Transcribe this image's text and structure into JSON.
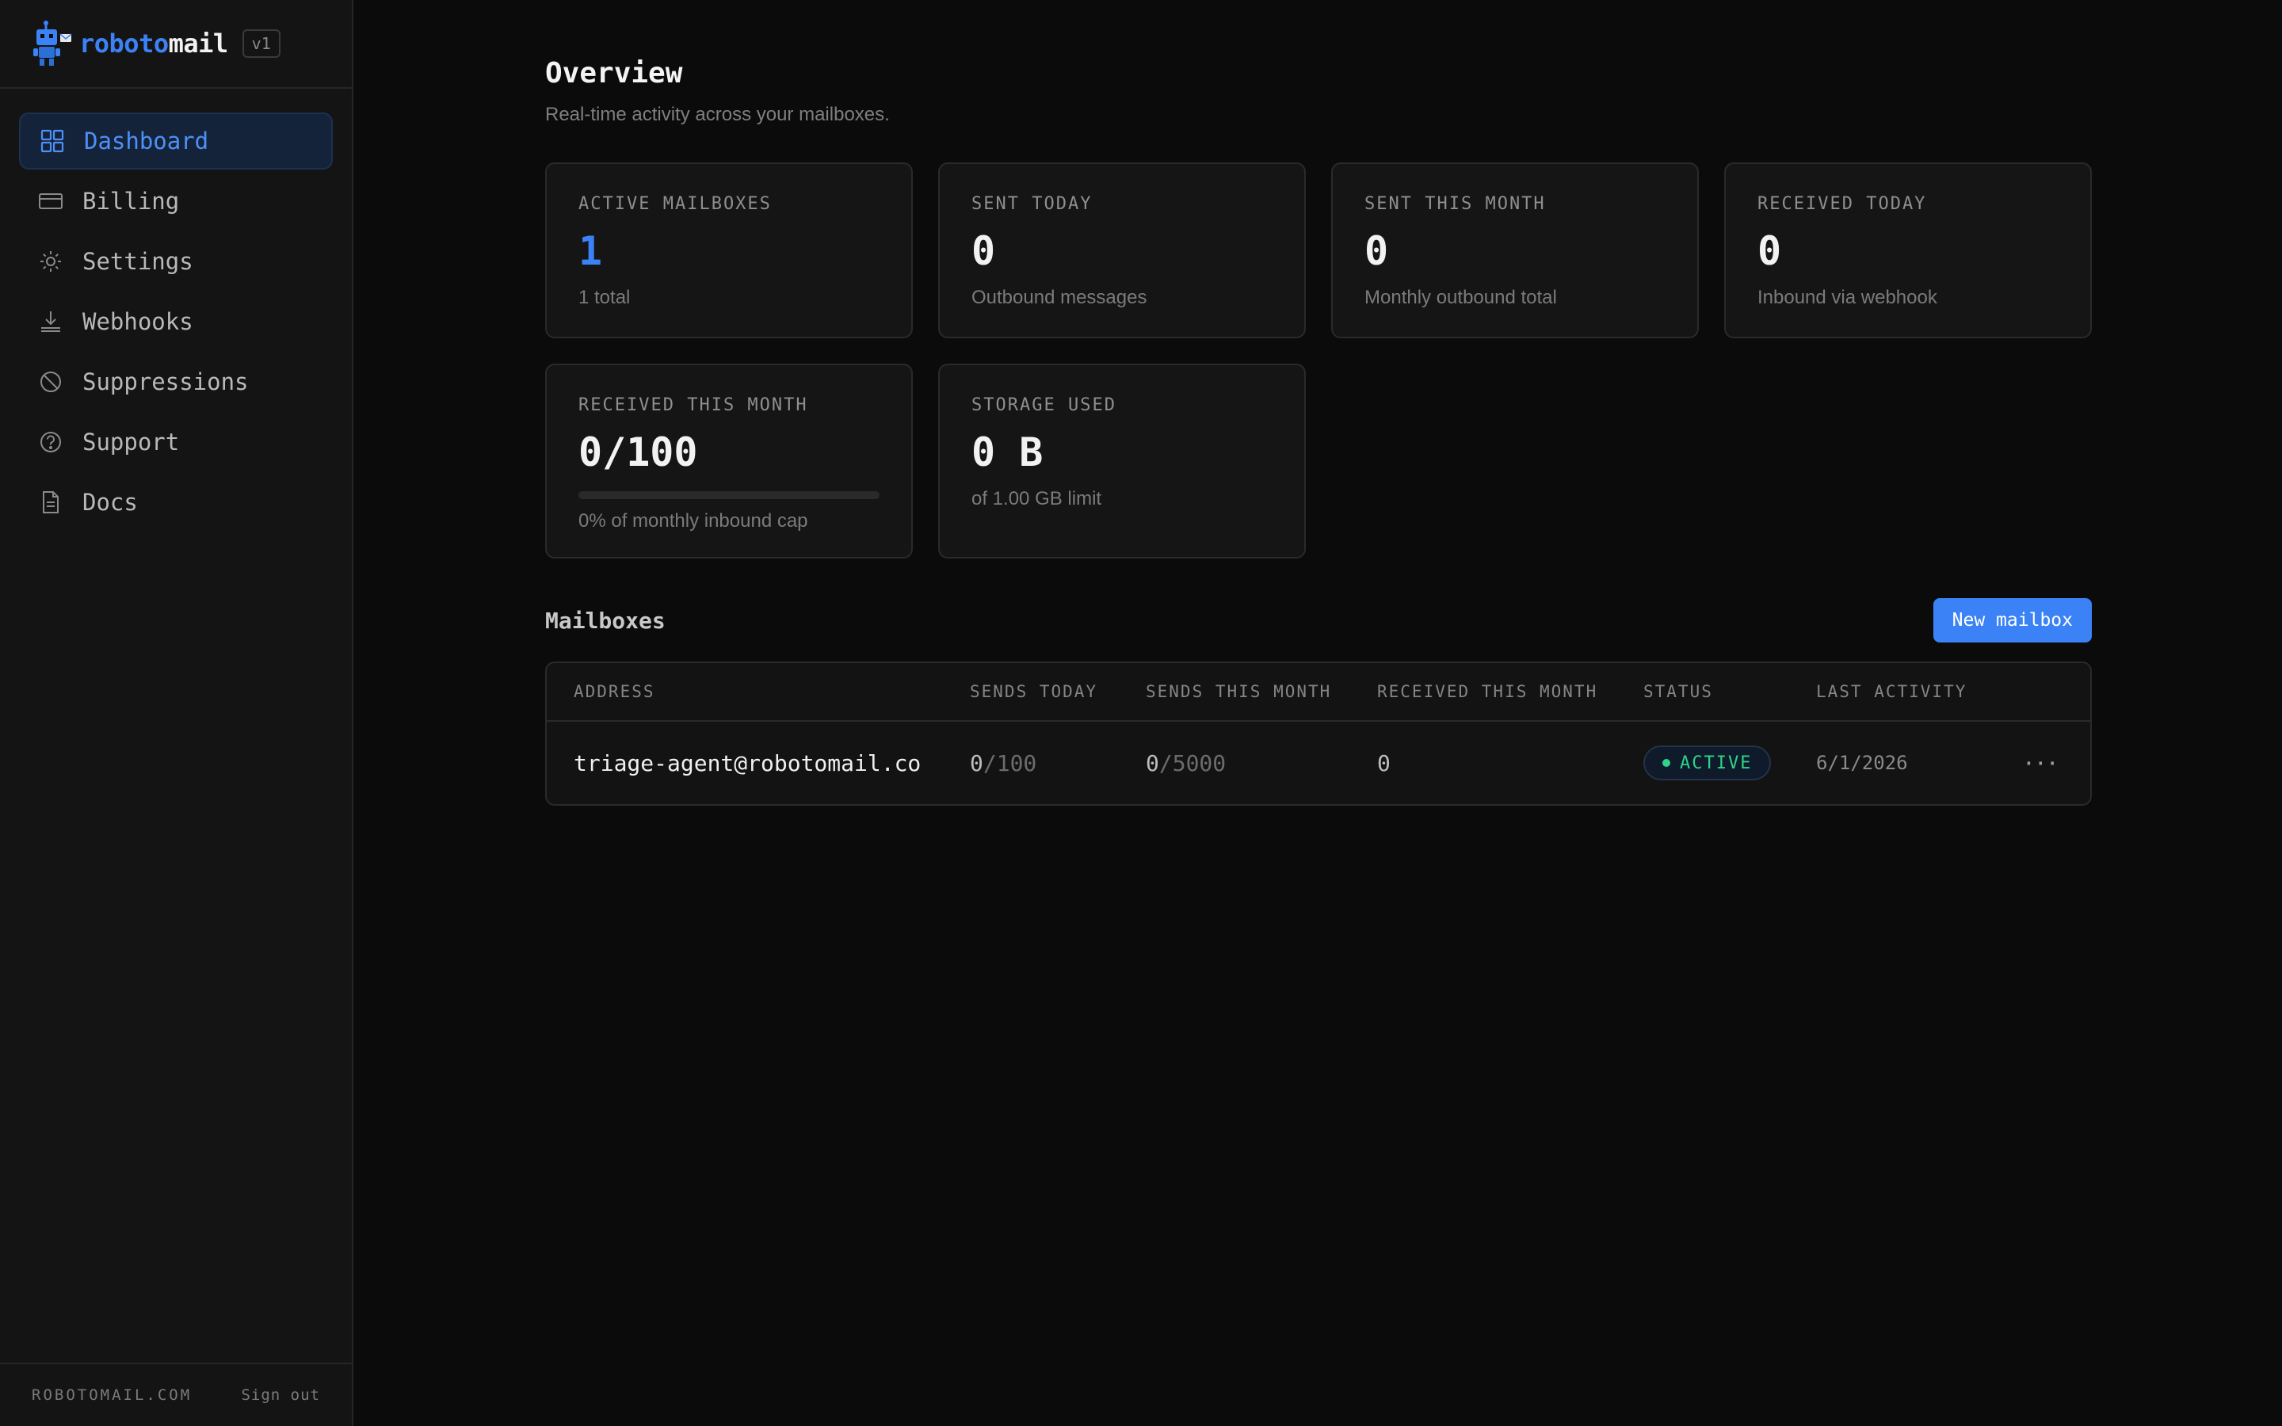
{
  "brand": {
    "name_part1": "roboto",
    "name_part2": "mail",
    "version": "v1"
  },
  "nav": {
    "items": [
      {
        "label": "Dashboard",
        "icon": "grid-icon",
        "active": true
      },
      {
        "label": "Billing",
        "icon": "credit-card-icon"
      },
      {
        "label": "Settings",
        "icon": "gear-icon"
      },
      {
        "label": "Webhooks",
        "icon": "download-icon"
      },
      {
        "label": "Suppressions",
        "icon": "block-icon"
      },
      {
        "label": "Support",
        "icon": "help-circle-icon"
      },
      {
        "label": "Docs",
        "icon": "document-icon"
      }
    ]
  },
  "footer": {
    "domain": "ROBOTOMAIL.COM",
    "signout": "Sign out"
  },
  "overview": {
    "title": "Overview",
    "subtitle": "Real-time activity across your mailboxes."
  },
  "stats": {
    "active_mailboxes": {
      "label": "ACTIVE MAILBOXES",
      "value": "1",
      "sub": "1 total"
    },
    "sent_today": {
      "label": "SENT TODAY",
      "value": "0",
      "sub": "Outbound messages"
    },
    "sent_month": {
      "label": "SENT THIS MONTH",
      "value": "0",
      "sub": "Monthly outbound total"
    },
    "received_today": {
      "label": "RECEIVED TODAY",
      "value": "0",
      "sub": "Inbound via webhook"
    },
    "received_month": {
      "label": "RECEIVED THIS MONTH",
      "value": "0/100",
      "progress_percent": 0,
      "sub": "0% of monthly inbound cap"
    },
    "storage": {
      "label": "STORAGE USED",
      "value": "0 B",
      "sub": "of 1.00 GB limit"
    }
  },
  "mailboxes": {
    "title": "Mailboxes",
    "new_button": "New mailbox",
    "columns": [
      "ADDRESS",
      "SENDS TODAY",
      "SENDS THIS MONTH",
      "RECEIVED THIS MONTH",
      "STATUS",
      "LAST ACTIVITY"
    ],
    "rows": [
      {
        "address": "triage-agent@robotomail.co",
        "sends_today": "0",
        "sends_today_limit": "/100",
        "sends_month": "0",
        "sends_month_limit": "/5000",
        "received_month": "0",
        "status": "ACTIVE",
        "last_activity": "6/1/2026",
        "menu": "···"
      }
    ]
  },
  "colors": {
    "accent": "#3b82f6",
    "status_active": "#2fd38a",
    "background": "#0b0b0b",
    "sidebar": "#141414"
  }
}
